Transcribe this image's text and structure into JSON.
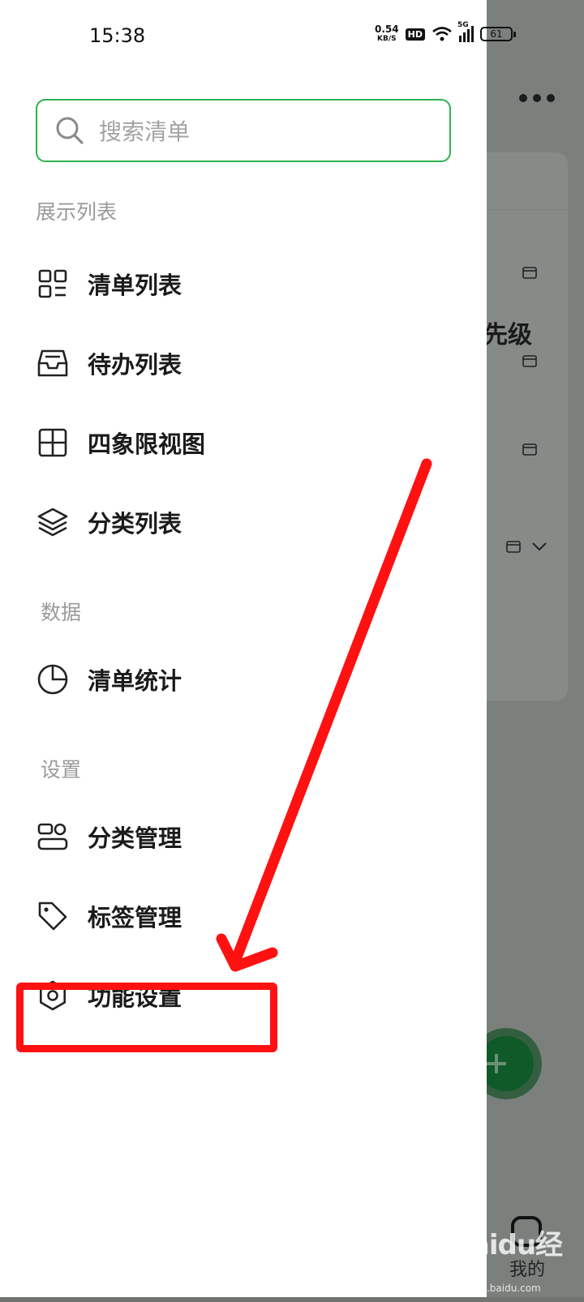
{
  "status_bar": {
    "time": "15:38",
    "net_speed": "0.54",
    "net_unit": "KB/S",
    "hd": "HD",
    "signal": "5G",
    "battery": "61"
  },
  "search": {
    "placeholder": "搜索清单"
  },
  "sections": {
    "display": "展示列表",
    "data": "数据",
    "settings": "设置"
  },
  "menu": {
    "list_view": "清单列表",
    "todo_list": "待办列表",
    "quadrant": "四象限视图",
    "category_list": "分类列表",
    "stats": "清单统计",
    "category_manage": "分类管理",
    "tag_manage": "标签管理",
    "feature_settings": "功能设置"
  },
  "background_app": {
    "partial_text": "先级",
    "bottom_tab": "我的"
  },
  "watermark": {
    "text": "Baidu经验",
    "sub": "jingyan.baidu.com"
  },
  "colors": {
    "accent_green": "#2db34f",
    "annotation_red": "#ff1111",
    "scrim": "#7b807d"
  }
}
